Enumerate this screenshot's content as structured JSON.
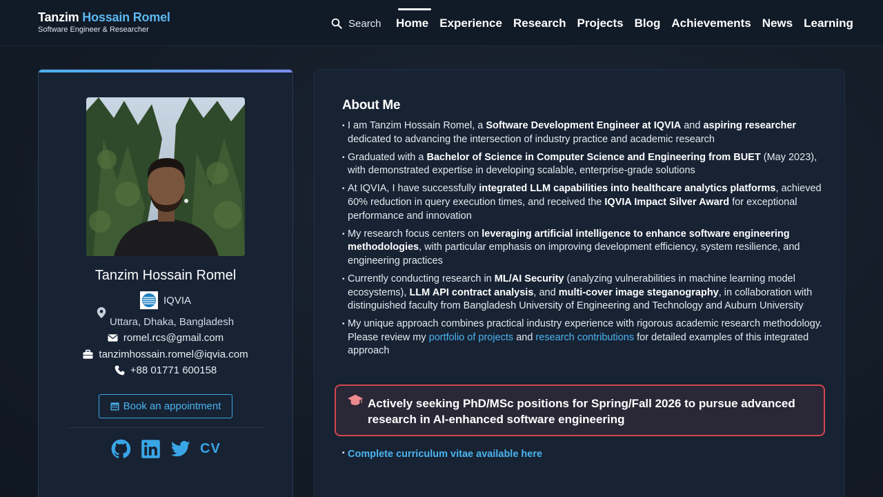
{
  "header": {
    "brand_first": "Tanzim",
    "brand_last": "Hossain Romel",
    "subtitle": "Software Engineer & Researcher",
    "search_label": "Search",
    "nav": [
      "Home",
      "Experience",
      "Research",
      "Projects",
      "Blog",
      "Achievements",
      "News",
      "Learning"
    ],
    "active_nav": "Home"
  },
  "profile": {
    "name": "Tanzim Hossain Romel",
    "organization": "IQVIA",
    "location": "Uttara, Dhaka, Bangladesh",
    "email": "romel.rcs@gmail.com",
    "work_email": "tanzimhossain.romel@iqvia.com",
    "phone": "+88 01771 600158",
    "book_label": "Book an appointment",
    "cv_label": "CV",
    "social_icons": [
      "github-icon",
      "linkedin-icon",
      "twitter-icon"
    ]
  },
  "about": {
    "title": "About Me",
    "b1": {
      "t1": "I am Tanzim Hossain Romel, a ",
      "s1": "Software Development Engineer at IQVIA",
      "t2": " and ",
      "s2": "aspiring researcher",
      "t3": " dedicated to advancing the intersection of industry practice and academic research"
    },
    "b2": {
      "t1": "Graduated with a ",
      "s1": "Bachelor of Science in Computer Science and Engineering from BUET",
      "t2": " (May 2023), with demonstrated expertise in developing scalable, enterprise-grade solutions"
    },
    "b3": {
      "t1": "At IQVIA, I have successfully ",
      "s1": "integrated LLM capabilities into healthcare analytics platforms",
      "t2": ", achieved 60% reduction in query execution times, and received the ",
      "s2": "IQVIA Impact Silver Award",
      "t3": " for exceptional performance and innovation"
    },
    "b4": {
      "t1": "My research focus centers on ",
      "s1": "leveraging artificial intelligence to enhance software engineering methodologies",
      "t2": ", with particular emphasis on improving development efficiency, system resilience, and engineering practices"
    },
    "b5": {
      "t1": "Currently conducting research in ",
      "s1": "ML/AI Security",
      "t2": " (analyzing vulnerabilities in machine learning model ecosystems), ",
      "s2": "LLM API contract analysis",
      "t3": ", and ",
      "s3": "multi-cover image steganography",
      "t4": ", in collaboration with distinguished faculty from Bangladesh University of Engineering and Technology and Auburn University"
    },
    "b6": {
      "t1": "My unique approach combines practical industry experience with rigorous academic research methodology. Please review my ",
      "l1": "portfolio of projects",
      "t2": " and ",
      "l2": "research contributions",
      "t3": " for detailed examples of this integrated approach"
    },
    "alert": "Actively seeking PhD/MSc positions for Spring/Fall 2026 to pursue advanced research in AI-enhanced software engineering",
    "cv_link": "Complete curriculum vitae available here"
  },
  "colors": {
    "accent": "#4cb4ee",
    "brand_accent": "#5ab8f0",
    "alert_border": "#d2464e"
  }
}
